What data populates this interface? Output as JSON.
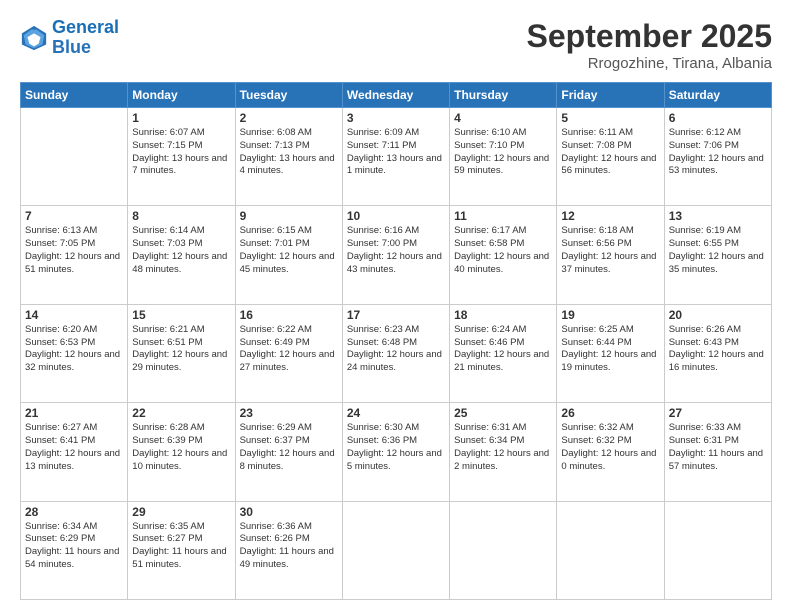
{
  "logo": {
    "line1": "General",
    "line2": "Blue"
  },
  "title": "September 2025",
  "subtitle": "Rrogozhine, Tirana, Albania",
  "days_of_week": [
    "Sunday",
    "Monday",
    "Tuesday",
    "Wednesday",
    "Thursday",
    "Friday",
    "Saturday"
  ],
  "weeks": [
    [
      {
        "day": "",
        "info": ""
      },
      {
        "day": "1",
        "info": "Sunrise: 6:07 AM\nSunset: 7:15 PM\nDaylight: 13 hours\nand 7 minutes."
      },
      {
        "day": "2",
        "info": "Sunrise: 6:08 AM\nSunset: 7:13 PM\nDaylight: 13 hours\nand 4 minutes."
      },
      {
        "day": "3",
        "info": "Sunrise: 6:09 AM\nSunset: 7:11 PM\nDaylight: 13 hours\nand 1 minute."
      },
      {
        "day": "4",
        "info": "Sunrise: 6:10 AM\nSunset: 7:10 PM\nDaylight: 12 hours\nand 59 minutes."
      },
      {
        "day": "5",
        "info": "Sunrise: 6:11 AM\nSunset: 7:08 PM\nDaylight: 12 hours\nand 56 minutes."
      },
      {
        "day": "6",
        "info": "Sunrise: 6:12 AM\nSunset: 7:06 PM\nDaylight: 12 hours\nand 53 minutes."
      }
    ],
    [
      {
        "day": "7",
        "info": "Sunrise: 6:13 AM\nSunset: 7:05 PM\nDaylight: 12 hours\nand 51 minutes."
      },
      {
        "day": "8",
        "info": "Sunrise: 6:14 AM\nSunset: 7:03 PM\nDaylight: 12 hours\nand 48 minutes."
      },
      {
        "day": "9",
        "info": "Sunrise: 6:15 AM\nSunset: 7:01 PM\nDaylight: 12 hours\nand 45 minutes."
      },
      {
        "day": "10",
        "info": "Sunrise: 6:16 AM\nSunset: 7:00 PM\nDaylight: 12 hours\nand 43 minutes."
      },
      {
        "day": "11",
        "info": "Sunrise: 6:17 AM\nSunset: 6:58 PM\nDaylight: 12 hours\nand 40 minutes."
      },
      {
        "day": "12",
        "info": "Sunrise: 6:18 AM\nSunset: 6:56 PM\nDaylight: 12 hours\nand 37 minutes."
      },
      {
        "day": "13",
        "info": "Sunrise: 6:19 AM\nSunset: 6:55 PM\nDaylight: 12 hours\nand 35 minutes."
      }
    ],
    [
      {
        "day": "14",
        "info": "Sunrise: 6:20 AM\nSunset: 6:53 PM\nDaylight: 12 hours\nand 32 minutes."
      },
      {
        "day": "15",
        "info": "Sunrise: 6:21 AM\nSunset: 6:51 PM\nDaylight: 12 hours\nand 29 minutes."
      },
      {
        "day": "16",
        "info": "Sunrise: 6:22 AM\nSunset: 6:49 PM\nDaylight: 12 hours\nand 27 minutes."
      },
      {
        "day": "17",
        "info": "Sunrise: 6:23 AM\nSunset: 6:48 PM\nDaylight: 12 hours\nand 24 minutes."
      },
      {
        "day": "18",
        "info": "Sunrise: 6:24 AM\nSunset: 6:46 PM\nDaylight: 12 hours\nand 21 minutes."
      },
      {
        "day": "19",
        "info": "Sunrise: 6:25 AM\nSunset: 6:44 PM\nDaylight: 12 hours\nand 19 minutes."
      },
      {
        "day": "20",
        "info": "Sunrise: 6:26 AM\nSunset: 6:43 PM\nDaylight: 12 hours\nand 16 minutes."
      }
    ],
    [
      {
        "day": "21",
        "info": "Sunrise: 6:27 AM\nSunset: 6:41 PM\nDaylight: 12 hours\nand 13 minutes."
      },
      {
        "day": "22",
        "info": "Sunrise: 6:28 AM\nSunset: 6:39 PM\nDaylight: 12 hours\nand 10 minutes."
      },
      {
        "day": "23",
        "info": "Sunrise: 6:29 AM\nSunset: 6:37 PM\nDaylight: 12 hours\nand 8 minutes."
      },
      {
        "day": "24",
        "info": "Sunrise: 6:30 AM\nSunset: 6:36 PM\nDaylight: 12 hours\nand 5 minutes."
      },
      {
        "day": "25",
        "info": "Sunrise: 6:31 AM\nSunset: 6:34 PM\nDaylight: 12 hours\nand 2 minutes."
      },
      {
        "day": "26",
        "info": "Sunrise: 6:32 AM\nSunset: 6:32 PM\nDaylight: 12 hours\nand 0 minutes."
      },
      {
        "day": "27",
        "info": "Sunrise: 6:33 AM\nSunset: 6:31 PM\nDaylight: 11 hours\nand 57 minutes."
      }
    ],
    [
      {
        "day": "28",
        "info": "Sunrise: 6:34 AM\nSunset: 6:29 PM\nDaylight: 11 hours\nand 54 minutes."
      },
      {
        "day": "29",
        "info": "Sunrise: 6:35 AM\nSunset: 6:27 PM\nDaylight: 11 hours\nand 51 minutes."
      },
      {
        "day": "30",
        "info": "Sunrise: 6:36 AM\nSunset: 6:26 PM\nDaylight: 11 hours\nand 49 minutes."
      },
      {
        "day": "",
        "info": ""
      },
      {
        "day": "",
        "info": ""
      },
      {
        "day": "",
        "info": ""
      },
      {
        "day": "",
        "info": ""
      }
    ]
  ]
}
